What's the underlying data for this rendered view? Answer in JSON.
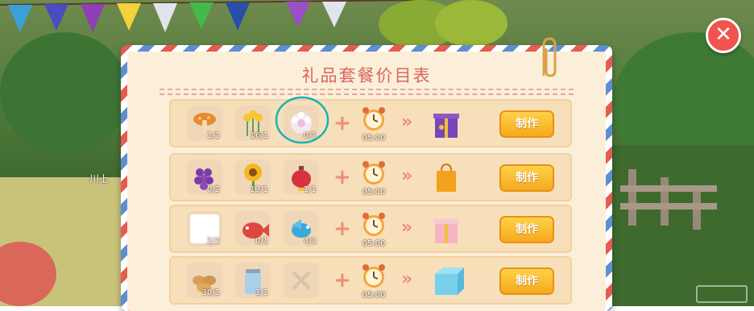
{
  "title": "礼品套餐价目表",
  "close_label": "✕",
  "map_label": "川上",
  "rows": [
    {
      "ingredients": [
        {
          "name": "mushroom-icon",
          "count": "1/1"
        },
        {
          "name": "yellow-flower-icon",
          "count": "16/1"
        },
        {
          "name": "white-flower-icon",
          "count": "0/1"
        }
      ],
      "time": "05:00",
      "result_icon": "purple-gift-box-icon",
      "button": "制作"
    },
    {
      "ingredients": [
        {
          "name": "grapes-icon",
          "count": "0/2"
        },
        {
          "name": "sunflower-icon",
          "count": "13/1"
        },
        {
          "name": "red-lantern-icon",
          "count": "1/1"
        }
      ],
      "time": "05:00",
      "result_icon": "orange-shopping-bag-icon",
      "button": "制作"
    },
    {
      "ingredients": [
        {
          "name": "white-cotton-icon",
          "count": "2/2"
        },
        {
          "name": "red-fish-icon",
          "count": "0/1"
        },
        {
          "name": "blue-bird-icon",
          "count": "4/1"
        }
      ],
      "time": "05:00",
      "result_icon": "pink-gift-box-icon",
      "button": "制作"
    },
    {
      "ingredients": [
        {
          "name": "potatoes-icon",
          "count": "30/1"
        },
        {
          "name": "glass-jar-icon",
          "count": "1/1"
        },
        {
          "name": "empty-slot-icon",
          "count": ""
        }
      ],
      "time": "05:00",
      "result_icon": "blue-gift-box-icon",
      "button": "制作"
    }
  ]
}
